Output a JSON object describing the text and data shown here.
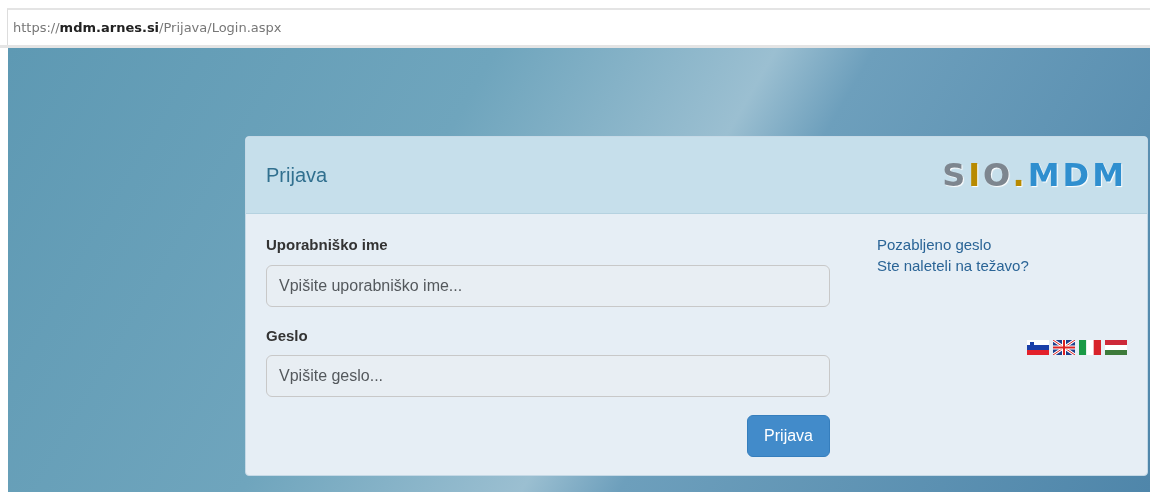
{
  "address_bar": {
    "url": "https://**mdm.arnes.si**/Prijava/Login.aspx"
  },
  "login_panel": {
    "title": "Prijava",
    "logo": [
      {
        "text": "S",
        "color": "#7d868f"
      },
      {
        "text": "I",
        "color": "#b88a00"
      },
      {
        "text": "O",
        "color": "#7d868f"
      },
      {
        "text": ".",
        "color": "#b88a00"
      },
      {
        "text": "MDM",
        "color": "#2f8fcf"
      }
    ],
    "fields": [
      {
        "label": "Uporabniško ime",
        "placeholder": "Vpišite uporabniško ime..."
      },
      {
        "label": "Geslo",
        "placeholder": "Vpišite geslo..."
      }
    ],
    "submit": "Prijava",
    "links": [
      "Pozabljeno geslo",
      "Ste naleteli na težavo?"
    ],
    "flags": [
      {
        "kind": "si"
      },
      {
        "kind": "gb"
      },
      {
        "kind": "it"
      },
      {
        "kind": "hu"
      }
    ]
  }
}
